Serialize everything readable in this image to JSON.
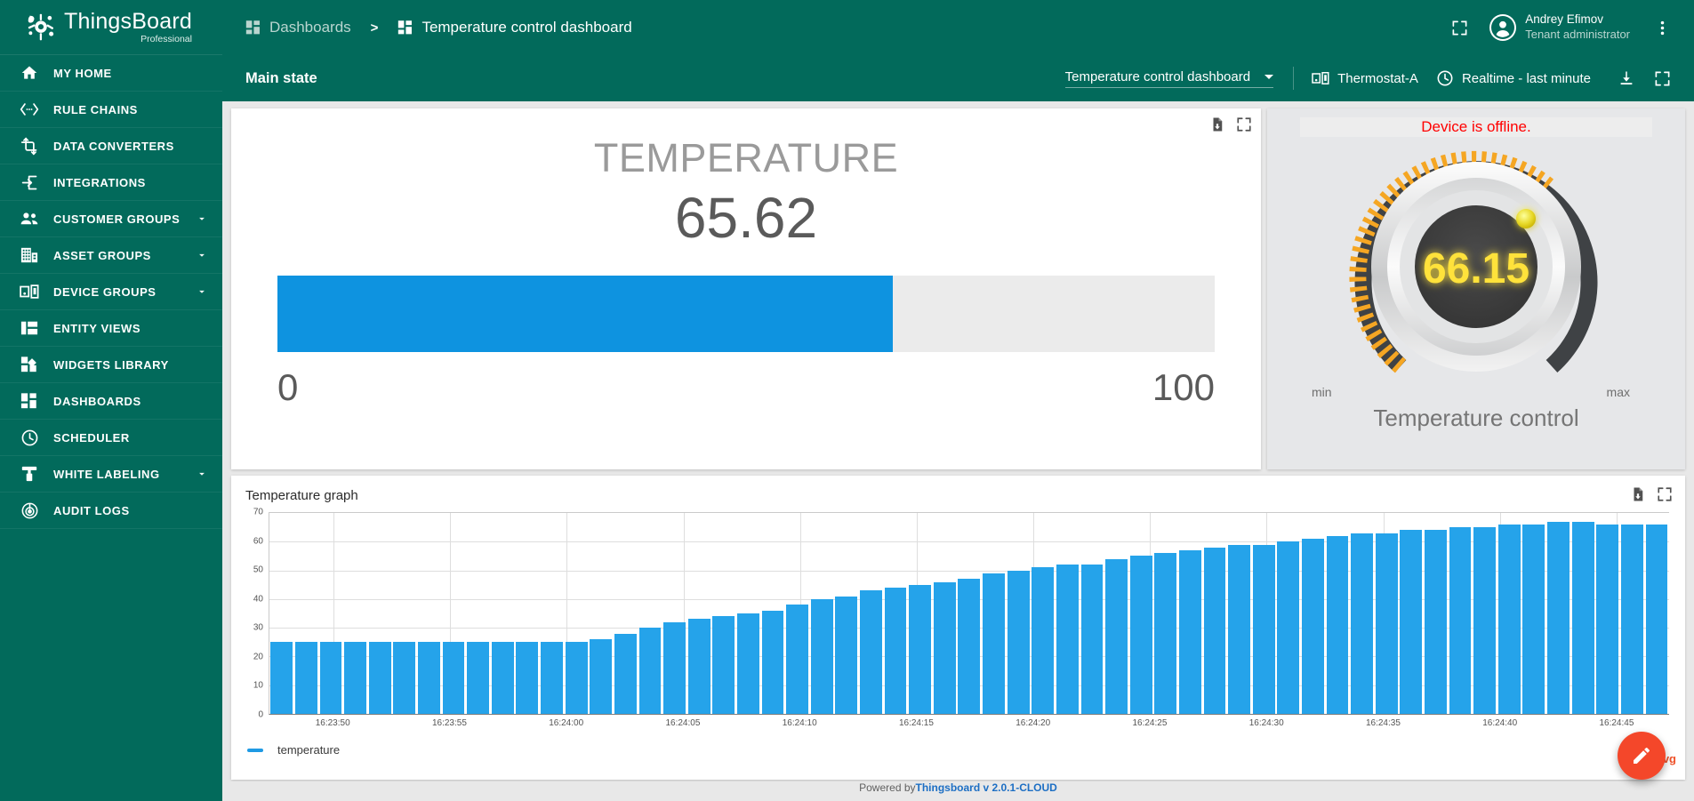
{
  "brand": {
    "title": "ThingsBoard",
    "subtitle": "Professional",
    "accent": "#026A5B"
  },
  "sidebar": {
    "items": [
      {
        "label": "MY HOME",
        "icon": "home-icon",
        "expandable": false
      },
      {
        "label": "RULE CHAINS",
        "icon": "rule-chains-icon",
        "expandable": false
      },
      {
        "label": "DATA CONVERTERS",
        "icon": "data-converters-icon",
        "expandable": false
      },
      {
        "label": "INTEGRATIONS",
        "icon": "integrations-icon",
        "expandable": false
      },
      {
        "label": "CUSTOMER GROUPS",
        "icon": "customer-groups-icon",
        "expandable": true
      },
      {
        "label": "ASSET GROUPS",
        "icon": "asset-groups-icon",
        "expandable": true
      },
      {
        "label": "DEVICE GROUPS",
        "icon": "device-groups-icon",
        "expandable": true
      },
      {
        "label": "ENTITY VIEWS",
        "icon": "entity-views-icon",
        "expandable": false
      },
      {
        "label": "WIDGETS LIBRARY",
        "icon": "widgets-library-icon",
        "expandable": false
      },
      {
        "label": "DASHBOARDS",
        "icon": "dashboards-icon",
        "expandable": false
      },
      {
        "label": "SCHEDULER",
        "icon": "scheduler-clock-icon",
        "expandable": false
      },
      {
        "label": "WHITE LABELING",
        "icon": "white-labeling-icon",
        "expandable": true
      },
      {
        "label": "AUDIT LOGS",
        "icon": "audit-logs-icon",
        "expandable": false
      }
    ]
  },
  "topbar": {
    "breadcrumb_root": "Dashboards",
    "breadcrumb_separator": ">",
    "breadcrumb_current": "Temperature control dashboard",
    "fullscreen_icon": "fullscreen-icon",
    "avatar_icon": "account-circle-icon",
    "user_name": "Andrey Efimov",
    "user_role": "Tenant administrator",
    "more_icon": "more-vert-icon"
  },
  "dashbar": {
    "state_title": "Main state",
    "dashboard_select": "Temperature control dashboard",
    "device_icon": "device-icon",
    "device_label": "Thermostat-A",
    "time_icon": "clock-icon",
    "time_label": "Realtime - last minute",
    "download_icon": "download-icon",
    "fullscreen_icon": "fullscreen-icon"
  },
  "gauge_widget": {
    "title": "TEMPERATURE",
    "value": "65.62",
    "min_label": "0",
    "max_label": "100",
    "fill_percent": 65.62,
    "bar_color": "#0e93e0",
    "export_icon": "export-icon",
    "fullscreen_icon": "fullscreen-icon"
  },
  "knob_widget": {
    "offline_message": "Device is offline.",
    "offline_color": "#ff0000",
    "value": "66.15",
    "value_color": "#ffe23a",
    "min_label": "min",
    "max_label": "max",
    "caption": "Temperature control",
    "dial_active_color": "#f5a623",
    "dial_track_color": "#3f4245"
  },
  "chart_widget": {
    "title": "Temperature graph",
    "export_icon": "export-icon",
    "fullscreen_icon": "fullscreen-icon",
    "legend_label": "temperature",
    "avg_label": "avg"
  },
  "chart_data": {
    "type": "bar",
    "title": "Temperature graph",
    "xlabel": "",
    "ylabel": "",
    "ylim": [
      0,
      70
    ],
    "yticks": [
      0,
      10,
      20,
      30,
      40,
      50,
      60,
      70
    ],
    "grid": true,
    "legend": [
      "temperature"
    ],
    "legend_position": "bottom-left",
    "series_color": "#25a3ea",
    "xticks": [
      "16:23:50",
      "16:23:55",
      "16:24:00",
      "16:24:05",
      "16:24:10",
      "16:24:15",
      "16:24:20",
      "16:24:25",
      "16:24:30",
      "16:24:35",
      "16:24:40",
      "16:24:45"
    ],
    "values": [
      25,
      25,
      25,
      25,
      25,
      25,
      25,
      25,
      25,
      25,
      25,
      25,
      25,
      26,
      28,
      30,
      32,
      33,
      34,
      35,
      36,
      38,
      40,
      41,
      43,
      44,
      45,
      46,
      47,
      49,
      50,
      51,
      52,
      52,
      54,
      55,
      56,
      57,
      58,
      59,
      59,
      60,
      61,
      62,
      63,
      63,
      64,
      64,
      65,
      65,
      66,
      66,
      67,
      67,
      66,
      66,
      66
    ]
  },
  "footer": {
    "prefix": "Powered by ",
    "link": "Thingsboard v 2.0.1-CLOUD"
  },
  "fab": {
    "icon": "edit-pencil-icon"
  }
}
